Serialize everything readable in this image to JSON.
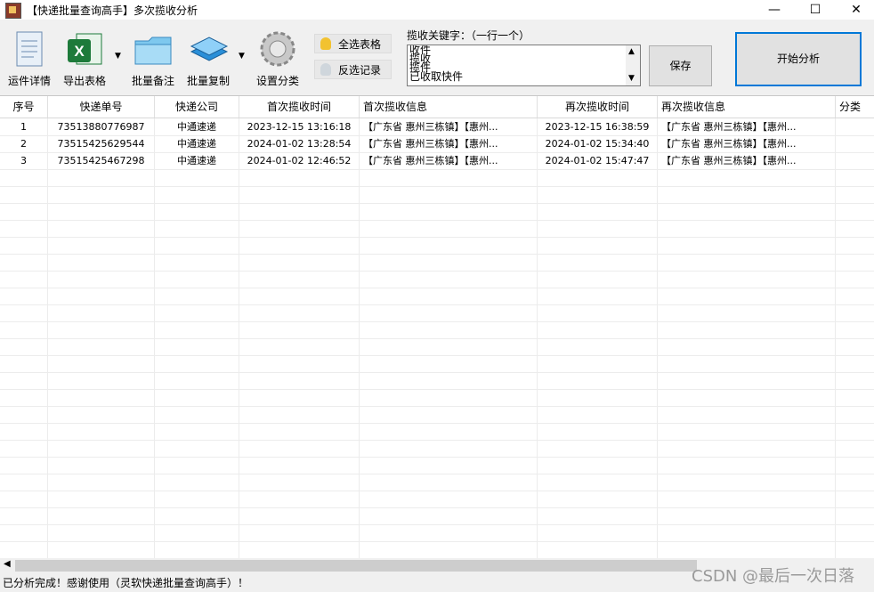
{
  "window": {
    "title": "【快递批量查询高手】多次揽收分析",
    "minimize": "—",
    "maximize": "☐",
    "close": "✕"
  },
  "toolbar": {
    "buttons": [
      {
        "label": "运件详情",
        "icon": "document-icon"
      },
      {
        "label": "导出表格",
        "icon": "excel-icon"
      },
      {
        "label": "批量备注",
        "icon": "folder-icon"
      },
      {
        "label": "批量复制",
        "icon": "copy-icon"
      },
      {
        "label": "设置分类",
        "icon": "gear-icon"
      }
    ],
    "select_all": "全选表格",
    "invert_select": "反选记录",
    "keyword_label": "揽收关键字：（一行一个）",
    "keywords": [
      "收件",
      "揽收",
      "揽件",
      "已收取快件"
    ],
    "save": "保存",
    "start": "开始分析"
  },
  "table": {
    "columns": [
      "序号",
      "快递单号",
      "快递公司",
      "首次揽收时间",
      "首次揽收信息",
      "再次揽收时间",
      "再次揽收信息",
      "分类"
    ],
    "rows": [
      [
        "1",
        "73513880776987",
        "中通速递",
        "2023-12-15 13:16:18",
        "【广东省 惠州三栋镇】【惠州...",
        "2023-12-15 16:38:59",
        "【广东省 惠州三栋镇】【惠州..."
      ],
      [
        "2",
        "73515425629544",
        "中通速递",
        "2024-01-02 13:28:54",
        "【广东省 惠州三栋镇】【惠州...",
        "2024-01-02 15:34:40",
        "【广东省 惠州三栋镇】【惠州..."
      ],
      [
        "3",
        "73515425467298",
        "中通速递",
        "2024-01-02 12:46:52",
        "【广东省 惠州三栋镇】【惠州...",
        "2024-01-02 15:47:47",
        "【广东省 惠州三栋镇】【惠州..."
      ]
    ]
  },
  "status": "已分析完成！感谢使用（灵软快递批量查询高手）！",
  "watermark": "CSDN @最后一次日落",
  "colors": {
    "accent": "#0078d7",
    "excel": "#1d7a3a",
    "bulb": "#f2c230"
  }
}
